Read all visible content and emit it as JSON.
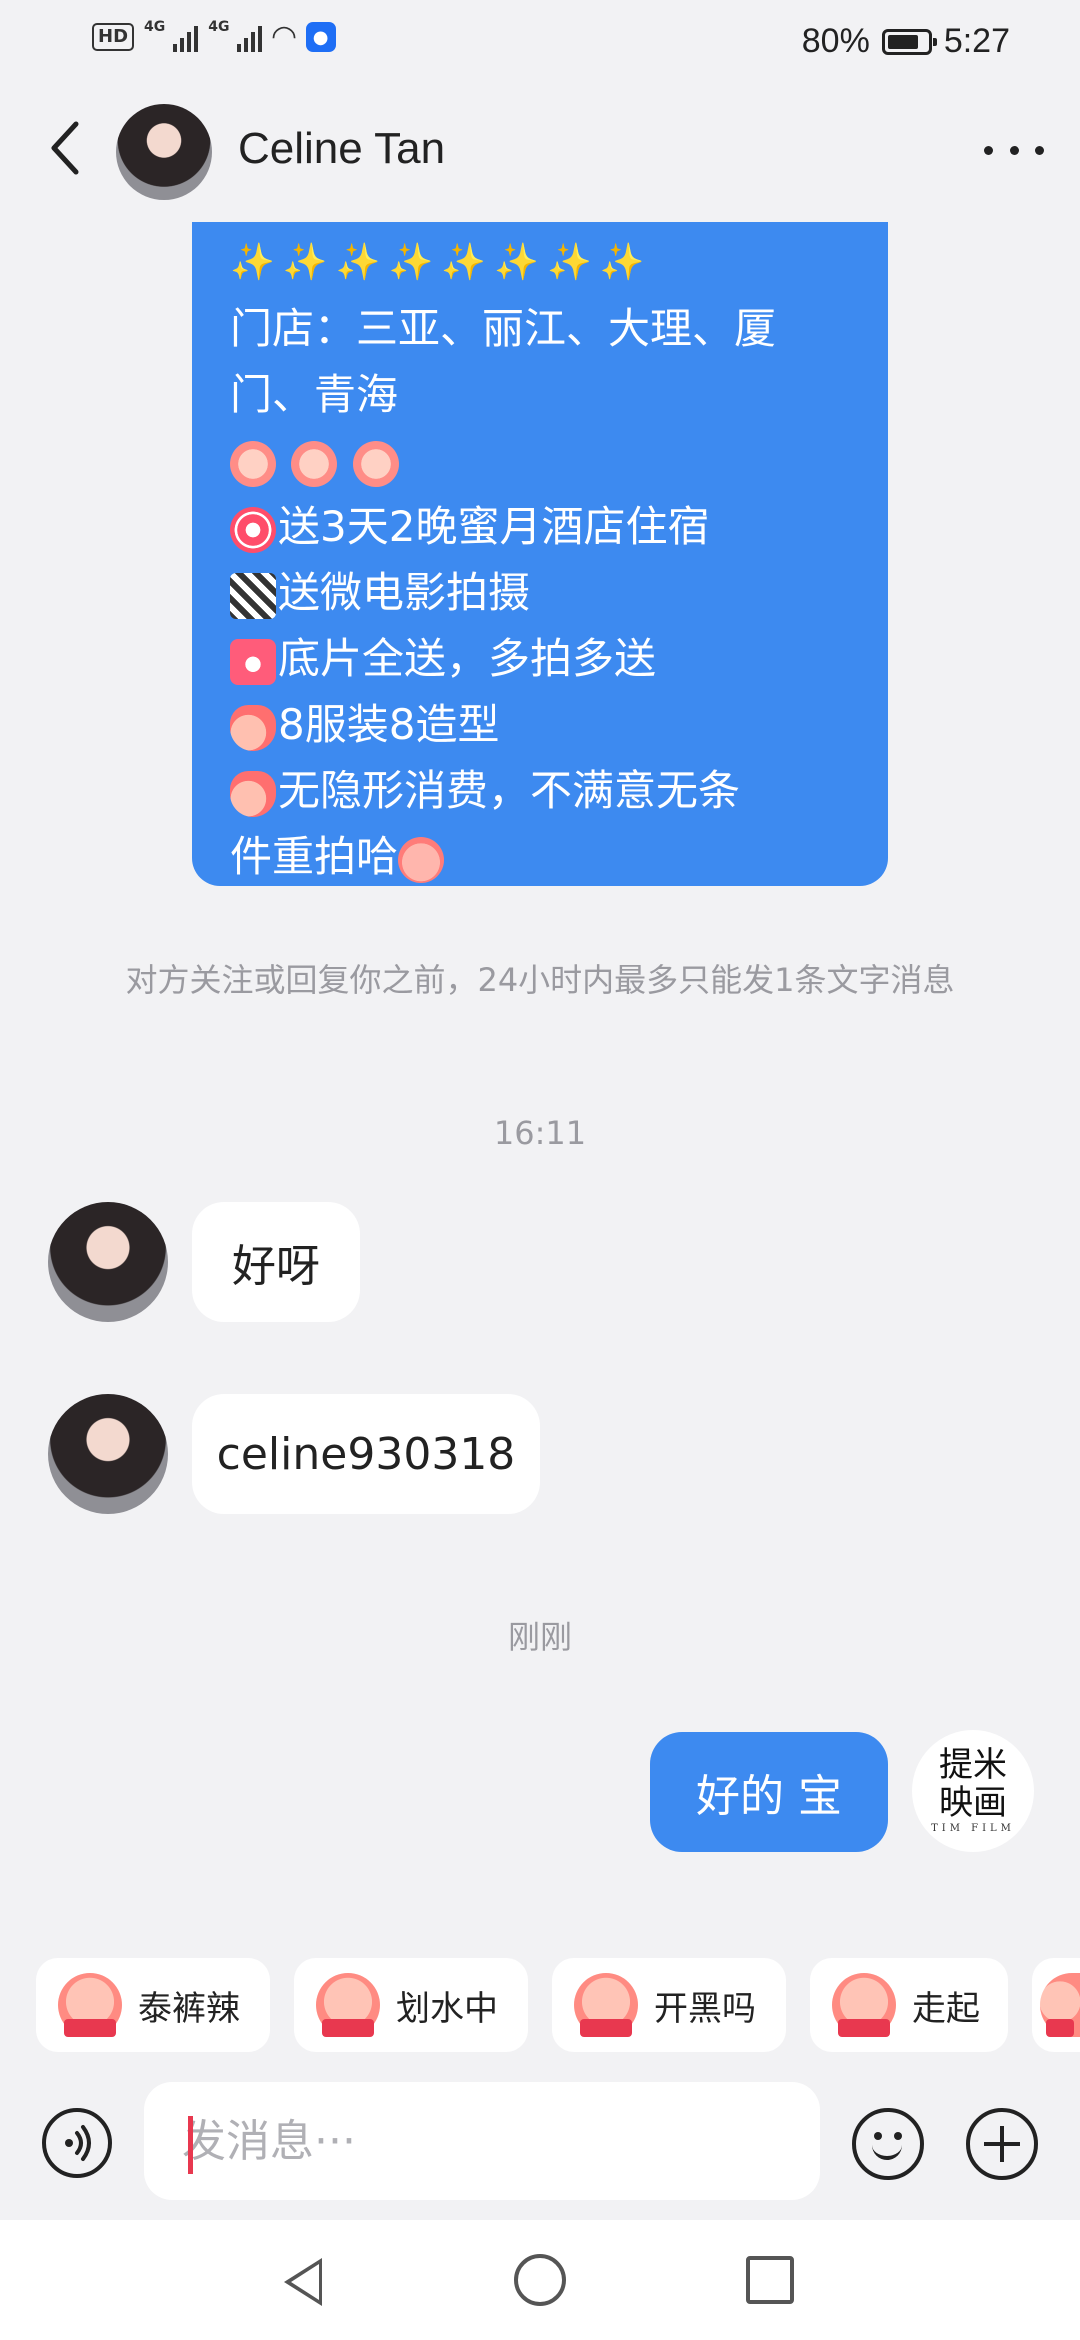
{
  "status_bar": {
    "hd_label": "HD",
    "network_1": "4G",
    "network_2": "4G",
    "battery_percent": "80%",
    "battery_level": 0.8,
    "time": "5:27"
  },
  "header": {
    "contact_name": "Celine Tan",
    "back_icon": "chevron-left-icon",
    "more_icon": "more-horizontal-icon"
  },
  "messages": {
    "promo_lines": [
      "✨✨✨✨✨✨✨✨",
      "门店：三亚、丽江、大理、厦",
      "门、青海",
      "",
      "送3天2晚蜜月酒店住宿",
      "送微电影拍摄",
      "底片全送，多拍多送",
      "8服装8造型",
      "无隐形消费，不满意无条",
      "件重拍哈"
    ],
    "notice": "对方关注或回复你之前，24小时内最多只能发1条文字消息",
    "time_1": "16:11",
    "reply_1": "好呀",
    "reply_2": "celine930318",
    "time_2": "刚刚",
    "my_message": "好的 宝",
    "my_avatar_text_1": "提米",
    "my_avatar_text_2": "映画",
    "my_avatar_small": "TIM FILM"
  },
  "stickers": [
    {
      "label": "泰裤辣"
    },
    {
      "label": "划水中"
    },
    {
      "label": "开黑吗"
    },
    {
      "label": "走起"
    }
  ],
  "input": {
    "placeholder": "发消息···"
  },
  "colors": {
    "accent": "#3d8af0",
    "background": "#f2f2f4",
    "caret": "#e8384f"
  }
}
